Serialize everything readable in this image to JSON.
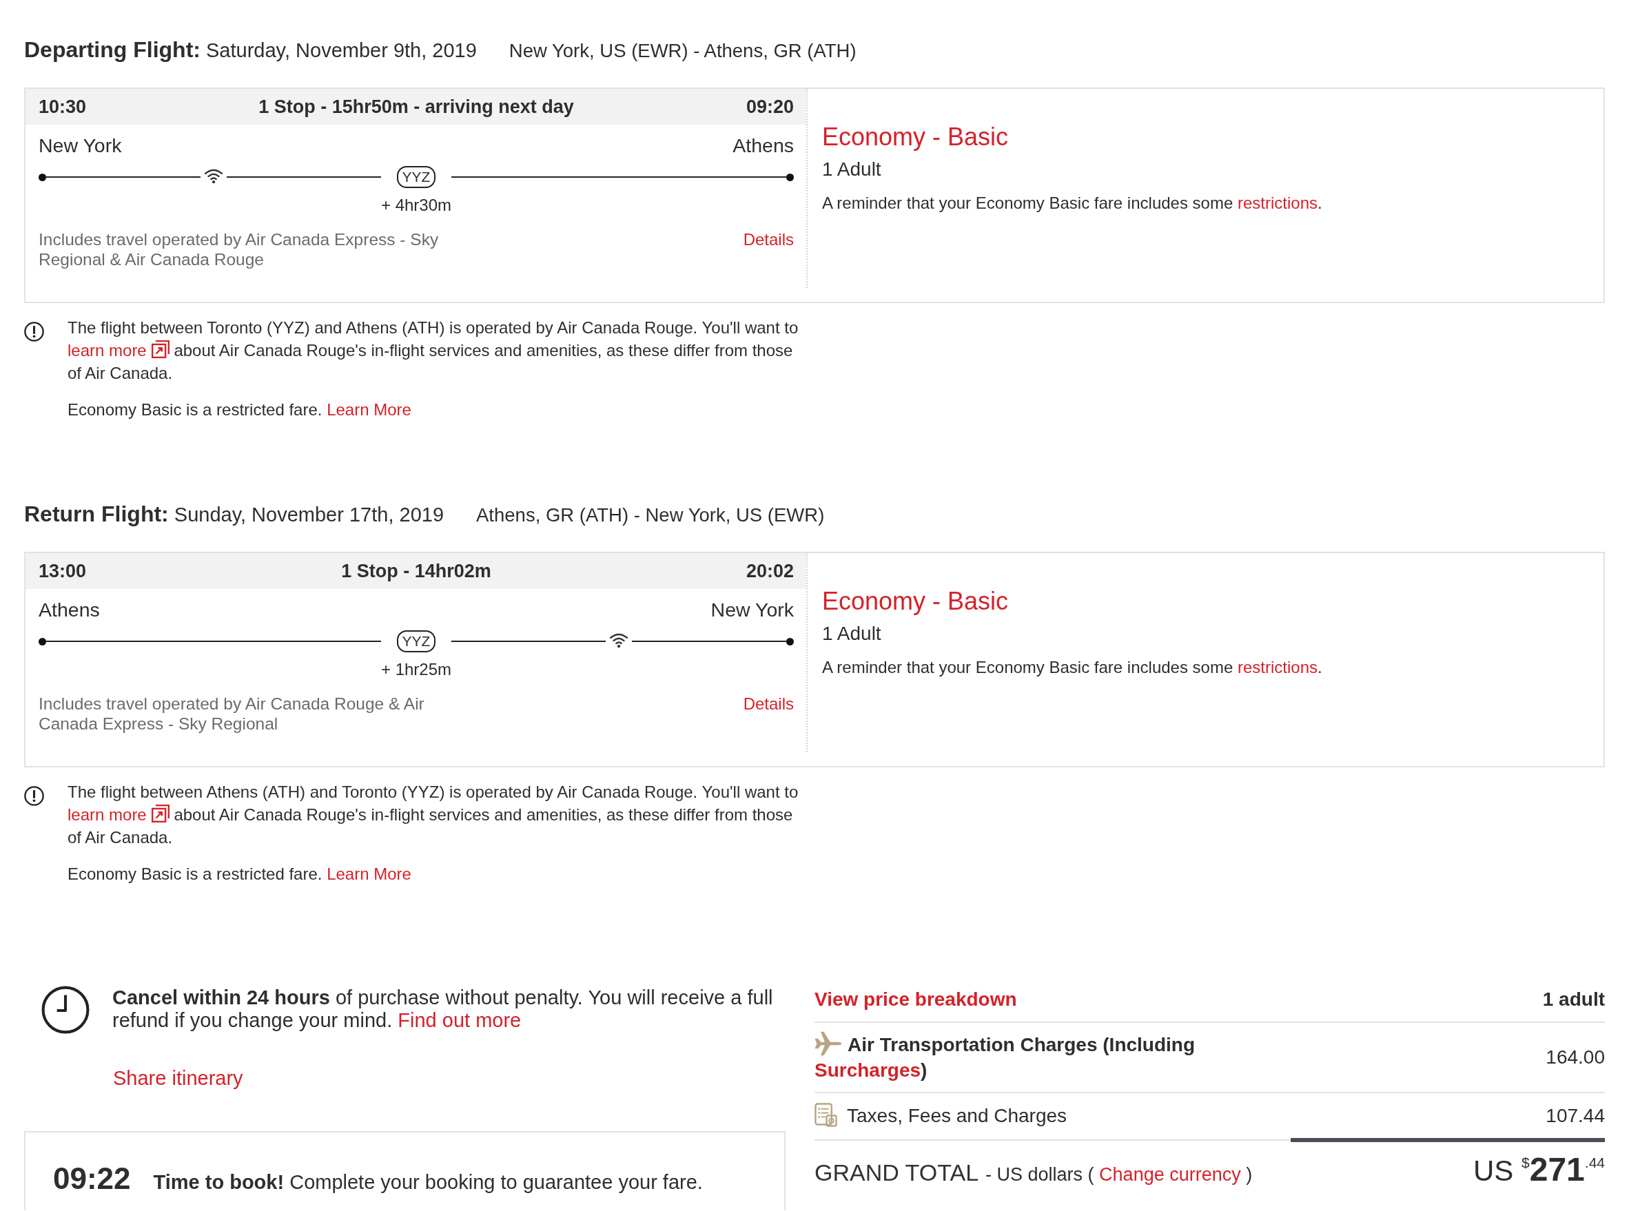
{
  "flights": [
    {
      "heading": {
        "label": "Departing Flight:",
        "date": "Saturday, November 9th, 2019",
        "route": "New York, US (EWR) - Athens, GR (ATH)"
      },
      "itinerary": {
        "depart_time": "10:30",
        "summary": "1 Stop - 15hr50m - arriving next day",
        "arrive_time": "09:20",
        "origin": "New York",
        "destination": "Athens",
        "legs": [
          {
            "wifi": true
          },
          {
            "wifi": false
          }
        ],
        "stop": {
          "code": "YYZ",
          "layover": "+ 4hr30m"
        },
        "operators": "Includes travel operated by Air Canada Express - Sky Regional & Air Canada Rouge",
        "details_link": "Details"
      },
      "fare": {
        "cabin": "Economy - Basic",
        "passengers": "1 Adult",
        "reminder": "A reminder that your Economy Basic fare includes some",
        "reminder_link": "restrictions",
        "reminder_end": "."
      },
      "notice": {
        "text_before": "The flight between Toronto (YYZ) and Athens (ATH) is operated by Air Canada Rouge. You'll want to",
        "link": "learn more",
        "text_after": "about Air Canada Rouge's in-flight services and amenities, as these differ from those of Air Canada."
      },
      "restriction": {
        "text": "Economy Basic is a restricted fare.",
        "link": "Learn More"
      }
    },
    {
      "heading": {
        "label": "Return Flight:",
        "date": "Sunday, November 17th, 2019",
        "route": "Athens, GR (ATH) - New York, US (EWR)"
      },
      "itinerary": {
        "depart_time": "13:00",
        "summary": "1 Stop - 14hr02m",
        "arrive_time": "20:02",
        "origin": "Athens",
        "destination": "New York",
        "legs": [
          {
            "wifi": false
          },
          {
            "wifi": true
          }
        ],
        "stop": {
          "code": "YYZ",
          "layover": "+ 1hr25m"
        },
        "operators": "Includes travel operated by Air Canada Rouge & Air Canada Express - Sky Regional",
        "details_link": "Details"
      },
      "fare": {
        "cabin": "Economy - Basic",
        "passengers": "1 Adult",
        "reminder": "A reminder that your Economy Basic fare includes some",
        "reminder_link": "restrictions",
        "reminder_end": "."
      },
      "notice": {
        "text_before": "The flight between Athens (ATH) and Toronto (YYZ) is operated by Air Canada Rouge. You'll want to",
        "link": "learn more",
        "text_after": "about Air Canada Rouge's in-flight services and amenities, as these differ from those of Air Canada."
      },
      "restriction": {
        "text": "Economy Basic is a restricted fare.",
        "link": "Learn More"
      }
    }
  ],
  "cancellation": {
    "text": "**Cancel within 24 hours** of purchase without penalty. You will receive a full refund if you change your mind.",
    "link": "Find out more"
  },
  "share_link": "Share itinerary",
  "timer": {
    "time": "09:22",
    "message": "**Time to book!** Complete your booking to guarantee your fare."
  },
  "price": {
    "breakdown_link": "View price breakdown",
    "column": "1 adult",
    "rows": [
      {
        "kind": "air",
        "label": "Air Transportation Charges (Including",
        "link": "Surcharges",
        "label_end": ")",
        "amount": "164.00"
      },
      {
        "kind": "taxes",
        "label": "Taxes, Fees and Charges",
        "amount": "107.44"
      }
    ],
    "grand_total": {
      "label": "GRAND TOTAL",
      "note": "- US dollars (",
      "link": "Change currency",
      "note_end": ")",
      "currency": "US",
      "symbol": "$",
      "whole": "271",
      "cents": ".44"
    }
  }
}
